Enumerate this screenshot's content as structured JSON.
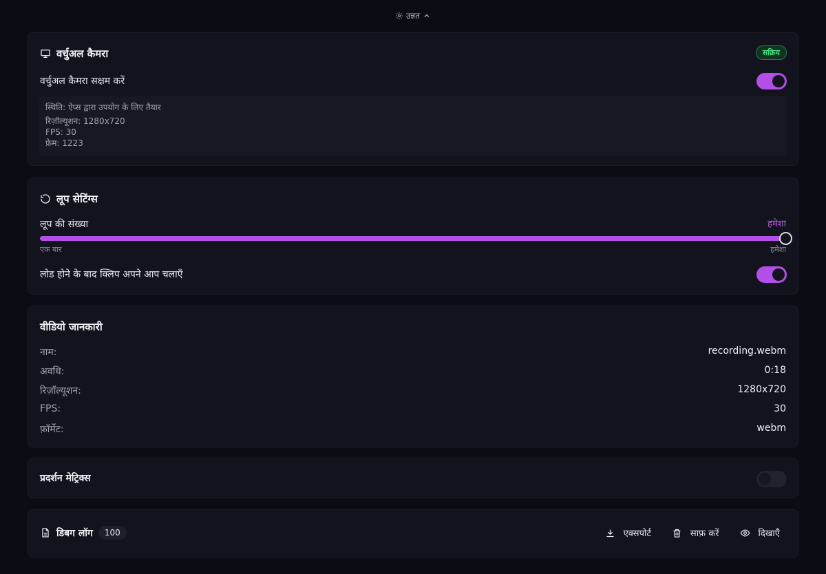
{
  "advanced": {
    "label": "उन्नत"
  },
  "virtual_camera": {
    "title": "वर्चुअल कैमरा",
    "badge": "सक्रिय",
    "enable_label": "वर्चुअल कैमरा सक्षम करें",
    "enabled": true,
    "status_lines": [
      "स्थिति: ऐप्स द्वारा उपयोग के लिए तैयार",
      "रिज़ॉल्यूशन: 1280x720",
      "FPS: 30",
      "फ्रेम: 1223"
    ]
  },
  "loop_settings": {
    "title": "लूप सेटिंग्स",
    "count_label": "लूप की संख्या",
    "count_value": "हमेशा",
    "slider_level": 1.0,
    "min_label": "एक बार",
    "max_label": "हमेशा",
    "autoplay_label": "लोड होने के बाद क्लिप अपने आप चलाएँ",
    "autoplay_enabled": true
  },
  "video_info": {
    "title": "वीडियो जानकारी",
    "rows": [
      {
        "key": "नाम:",
        "value": "recording.webm"
      },
      {
        "key": "अवधि:",
        "value": "0:18"
      },
      {
        "key": "रिज़ॉल्यूशन:",
        "value": "1280x720"
      },
      {
        "key": "FPS:",
        "value": "30"
      },
      {
        "key": "फ़ॉर्मेट:",
        "value": "webm"
      }
    ]
  },
  "performance": {
    "title": "प्रदर्शन मेट्रिक्स",
    "enabled": false
  },
  "debug_log": {
    "title": "डिबग लॉग",
    "count": "100",
    "export_label": "एक्सपोर्ट",
    "clear_label": "साफ़ करें",
    "show_label": "दिखाएँ"
  },
  "colors": {
    "accent": "#b44ee8",
    "active": "#4ade80",
    "background": "#0c0d14",
    "card": "#12131c"
  }
}
